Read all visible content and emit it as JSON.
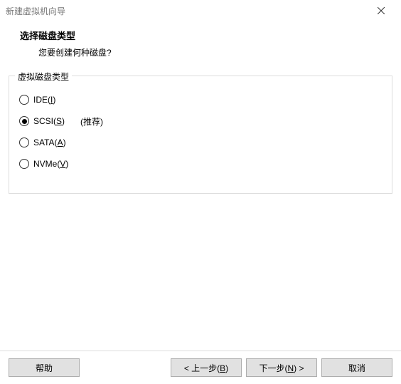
{
  "window": {
    "title": "新建虚拟机向导"
  },
  "header": {
    "title": "选择磁盘类型",
    "subtitle": "您要创建何种磁盘?"
  },
  "group": {
    "legend": "虚拟磁盘类型",
    "recommended": "(推荐)",
    "options": {
      "ide": {
        "prefix": "IDE(",
        "accel": "I",
        "suffix": ")",
        "selected": false
      },
      "scsi": {
        "prefix": "SCSI(",
        "accel": "S",
        "suffix": ")",
        "selected": true
      },
      "sata": {
        "prefix": "SATA(",
        "accel": "A",
        "suffix": ")",
        "selected": false
      },
      "nvme": {
        "prefix": "NVMe(",
        "accel": "V",
        "suffix": ")",
        "selected": false
      }
    }
  },
  "buttons": {
    "help": "帮助",
    "back": {
      "prefix": "< 上一步(",
      "accel": "B",
      "suffix": ")"
    },
    "next": {
      "prefix": "下一步(",
      "accel": "N",
      "suffix": ") >"
    },
    "cancel": "取消"
  }
}
